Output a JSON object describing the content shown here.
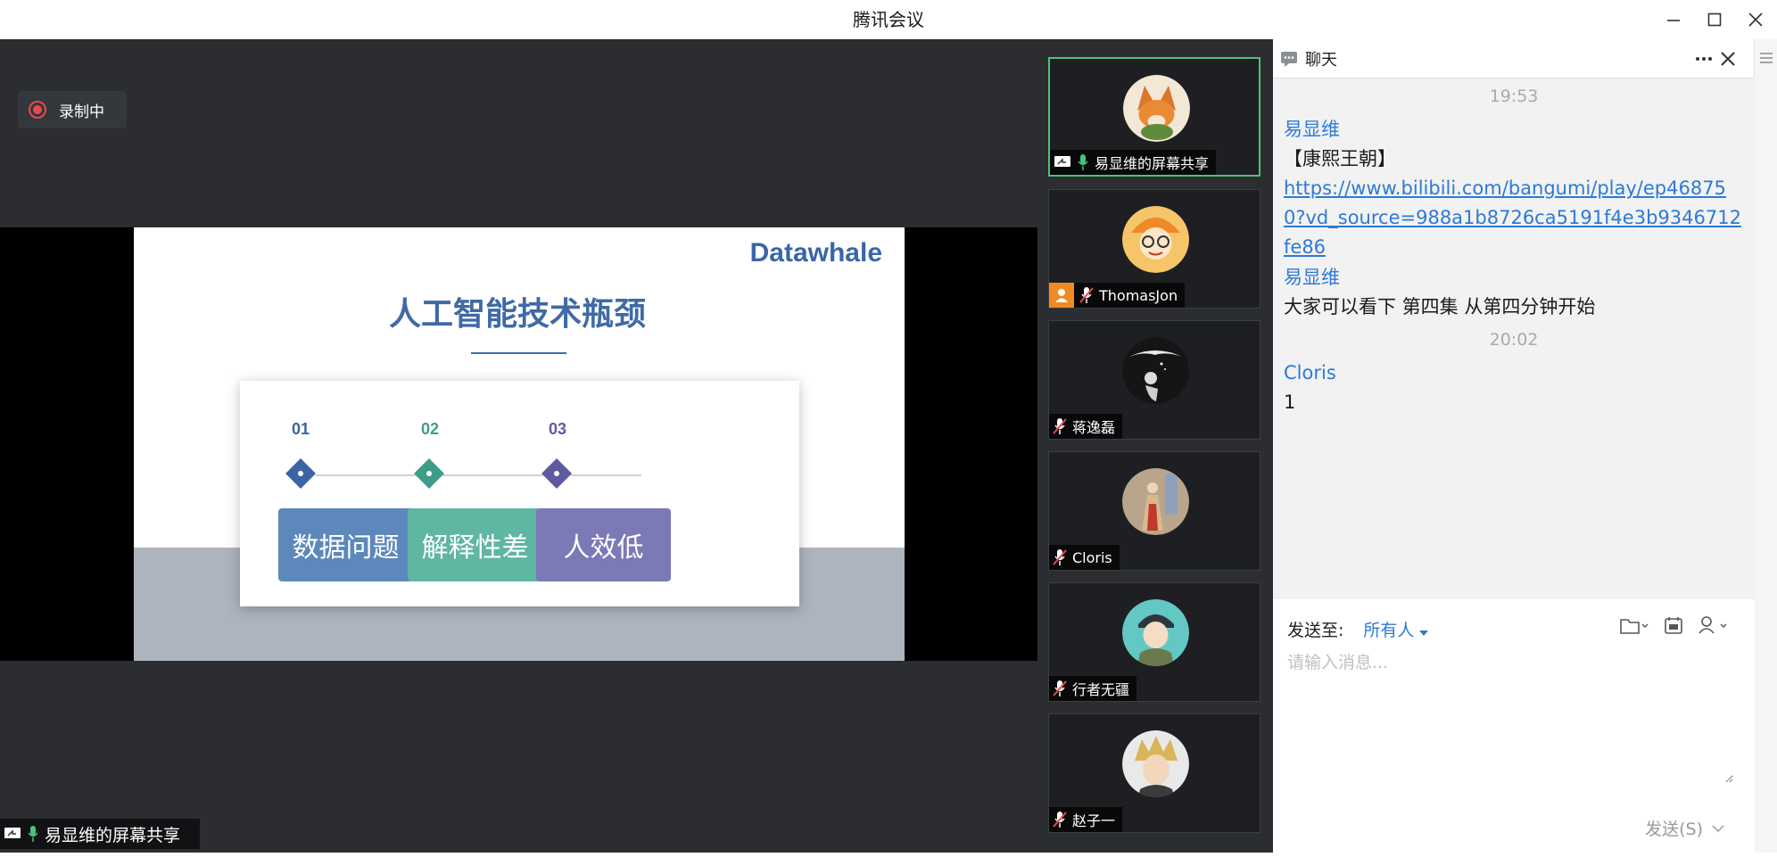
{
  "window": {
    "title": "腾讯会议"
  },
  "recording": {
    "label": "录制中"
  },
  "slide": {
    "brand": "Datawhale",
    "title": "人工智能技术瓶颈",
    "steps": [
      {
        "num": "01",
        "label": "数据问题",
        "color": "#5d88bb",
        "accent": "#3a64a3"
      },
      {
        "num": "02",
        "label": "解释性差",
        "color": "#5fb6a3",
        "accent": "#3e9d8a"
      },
      {
        "num": "03",
        "label": "人效低",
        "color": "#7b79b6",
        "accent": "#5e5aa0"
      }
    ]
  },
  "share_label": "易显维的屏幕共享",
  "participants": [
    {
      "name": "易显维的屏幕共享",
      "active": true,
      "mic": "on",
      "screen": true,
      "avatar": "fox-avatar"
    },
    {
      "name": "ThomasJon",
      "active": false,
      "mic": "off",
      "host": true,
      "avatar": "tiger-avatar"
    },
    {
      "name": "蒋逸磊",
      "active": false,
      "mic": "off",
      "avatar": "dark-sketch-avatar"
    },
    {
      "name": "Cloris",
      "active": false,
      "mic": "off",
      "avatar": "woman-avatar"
    },
    {
      "name": "行者无疆",
      "active": false,
      "mic": "off",
      "avatar": "anime-boy-avatar"
    },
    {
      "name": "赵子一",
      "active": false,
      "mic": "off",
      "avatar": "blond-hero-avatar"
    }
  ],
  "chat": {
    "title": "聊天",
    "messages": [
      {
        "time": "19:53"
      },
      {
        "sender": "易显维",
        "text": "【康熙王朝】"
      },
      {
        "link": "https://www.bilibili.com/bangumi/play/ep468750?vd_source=988a1b8726ca5191f4e3b9346712fe86"
      },
      {
        "sender": "易显维",
        "text": "大家可以看下 第四集 从第四分钟开始"
      },
      {
        "time": "20:02"
      },
      {
        "sender": "Cloris",
        "text": "1"
      }
    ],
    "send_to_label": "发送至:",
    "send_to_target": "所有人",
    "input_placeholder": "请输入消息...",
    "send_button": "发送(S)"
  },
  "colors": {
    "active_border": "#4cc27a",
    "link": "#2d7ad6",
    "record": "#e84a4a"
  }
}
